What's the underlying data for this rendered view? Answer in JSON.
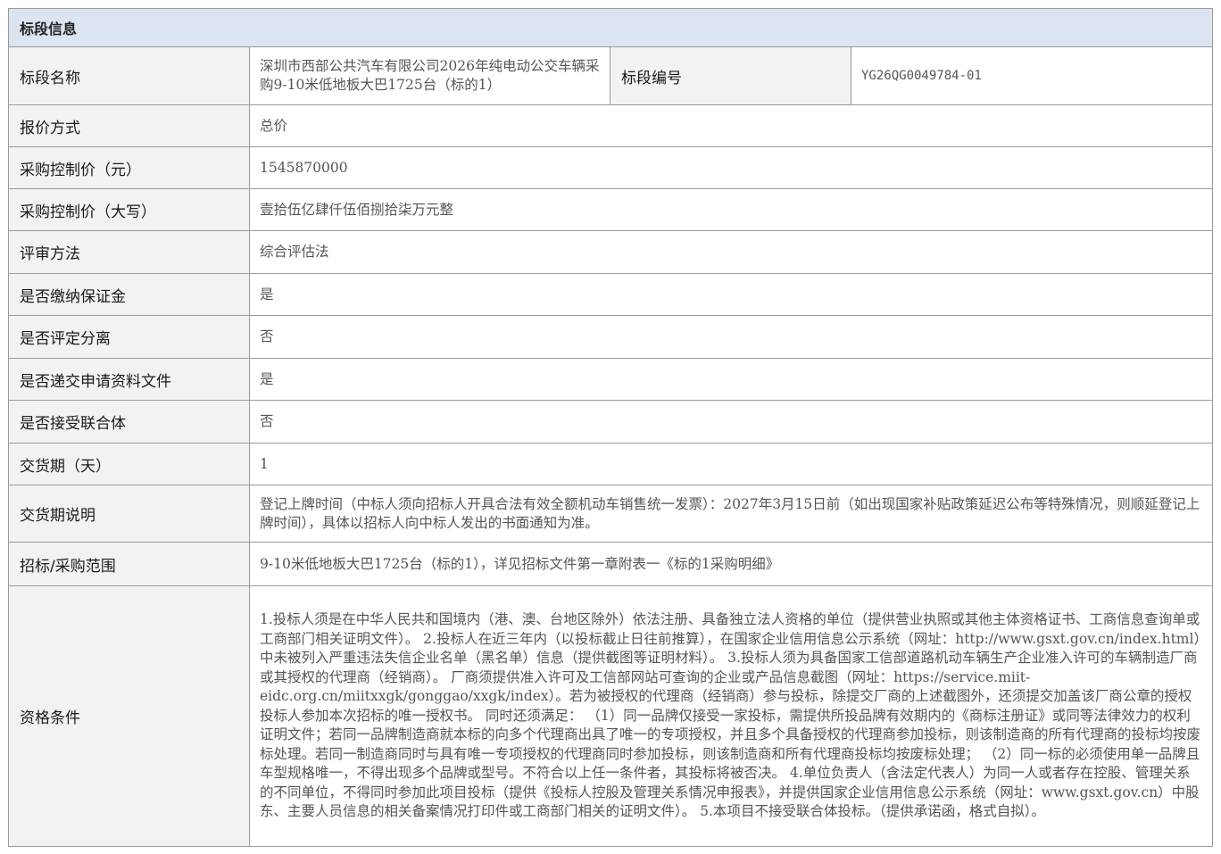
{
  "section_title": "标段信息",
  "rows": {
    "name": {
      "label": "标段名称",
      "value": "深圳市西部公共汽车有限公司2026年纯电动公交车辆采购9-10米低地板大巴1725台（标的1）"
    },
    "code": {
      "label": "标段编号",
      "value": "YG26QG0049784-01"
    },
    "quote_method": {
      "label": "报价方式",
      "value": "总价"
    },
    "price_control": {
      "label": "采购控制价（元）",
      "value": "1545870000"
    },
    "price_control_upper": {
      "label": "采购控制价（大写）",
      "value": "壹拾伍亿肆仟伍佰捌拾柒万元整"
    },
    "eval_method": {
      "label": "评审方法",
      "value": "综合评估法"
    },
    "deposit": {
      "label": "是否缴纳保证金",
      "value": "是"
    },
    "separate_eval": {
      "label": "是否评定分离",
      "value": "否"
    },
    "submit_docs": {
      "label": "是否递交申请资料文件",
      "value": "是"
    },
    "consortium": {
      "label": "是否接受联合体",
      "value": "否"
    },
    "delivery_days": {
      "label": "交货期（天）",
      "value": "1"
    },
    "delivery_desc": {
      "label": "交货期说明",
      "value": "登记上牌时间（中标人须向招标人开具合法有效全额机动车销售统一发票）：2027年3月15日前（如出现国家补贴政策延迟公布等特殊情况，则顺延登记上牌时间），具体以招标人向中标人发出的书面通知为准。"
    },
    "scope": {
      "label": "招标/采购范围",
      "value": "9-10米低地板大巴1725台（标的1），详见招标文件第一章附表一《标的1采购明细》"
    },
    "qualification": {
      "label": "资格条件",
      "value": "1.投标人须是在中华人民共和国境内（港、澳、台地区除外）依法注册、具备独立法人资格的单位（提供营业执照或其他主体资格证书、工商信息查询单或工商部门相关证明文件）。 2.投标人在近三年内（以投标截止日往前推算），在国家企业信用信息公示系统（网址：http://www.gsxt.gov.cn/index.html）中未被列入严重违法失信企业名单（黑名单）信息（提供截图等证明材料）。 3.投标人须为具备国家工信部道路机动车辆生产企业准入许可的车辆制造厂商或其授权的代理商（经销商）。 厂商须提供准入许可及工信部网站可查询的企业或产品信息截图（网址：https://service.miit-eidc.org.cn/miitxxgk/gonggao/xxgk/index）。若为被授权的代理商（经销商）参与投标，除提交厂商的上述截图外，还须提交加盖该厂商公章的授权投标人参加本次招标的唯一授权书。 同时还须满足： （1）同一品牌仅接受一家投标，需提供所投品牌有效期内的《商标注册证》或同等法律效力的权利证明文件；若同一品牌制造商就本标的向多个代理商出具了唯一的专项授权，并且多个具备授权的代理商参加投标，则该制造商的所有代理商的投标均按废标处理。若同一制造商同时与具有唯一专项授权的代理商同时参加投标，则该制造商和所有代理商投标均按废标处理； （2）同一标的必须使用单一品牌且车型规格唯一，不得出现多个品牌或型号。不符合以上任一条件者，其投标将被否决。 4.单位负责人（含法定代表人）为同一人或者存在控股、管理关系的不同单位，不得同时参加此项目投标（提供《投标人控股及管理关系情况申报表》，并提供国家企业信用信息公示系统（网址：www.gsxt.gov.cn）中股东、主要人员信息的相关备案情况打印件或工商部门相关的证明文件）。 5.本项目不接受联合体投标。（提供承诺函，格式自拟）。"
    }
  }
}
